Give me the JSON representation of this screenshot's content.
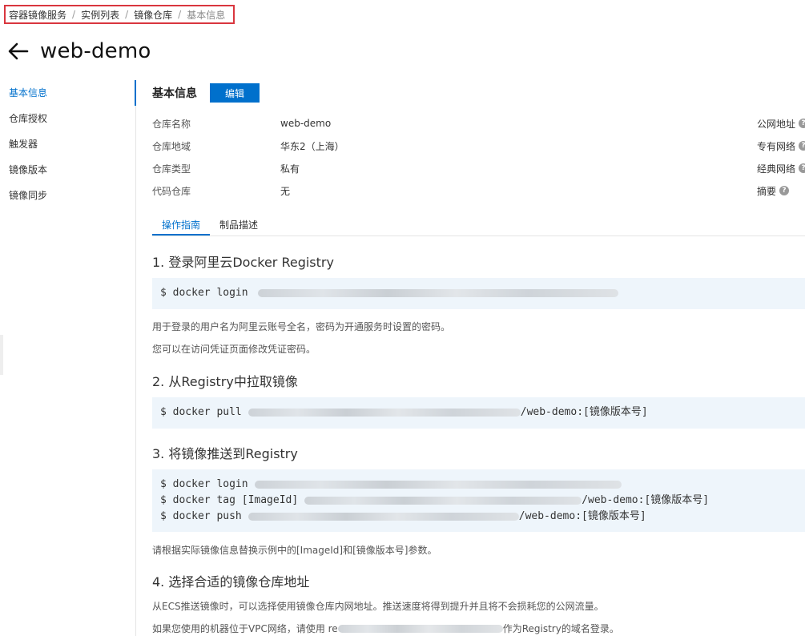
{
  "breadcrumb": {
    "items": [
      "容器镜像服务",
      "实例列表",
      "镜像仓库",
      "基本信息"
    ],
    "separator": "/"
  },
  "header": {
    "back_icon": "arrow-left-icon",
    "title": "web-demo"
  },
  "sidebar": {
    "items": [
      {
        "label": "基本信息",
        "active": true
      },
      {
        "label": "仓库授权",
        "active": false
      },
      {
        "label": "触发器",
        "active": false
      },
      {
        "label": "镜像版本",
        "active": false
      },
      {
        "label": "镜像同步",
        "active": false
      }
    ]
  },
  "basic_info": {
    "title": "基本信息",
    "edit_label": "编辑",
    "fields": [
      {
        "label": "仓库名称",
        "value": "web-demo"
      },
      {
        "label": "仓库地域",
        "value": "华东2（上海）"
      },
      {
        "label": "仓库类型",
        "value": "私有"
      },
      {
        "label": "代码仓库",
        "value": "无"
      }
    ],
    "right_fields": [
      {
        "label": "公网地址",
        "icon": "help-icon"
      },
      {
        "label": "专有网络",
        "icon": "help-icon"
      },
      {
        "label": "经典网络",
        "icon": "help-icon"
      },
      {
        "label": "摘要",
        "icon": "help-icon"
      }
    ]
  },
  "tabs": [
    {
      "label": "操作指南",
      "active": true
    },
    {
      "label": "制品描述",
      "active": false
    }
  ],
  "guide": {
    "step1": {
      "title": "1. 登录阿里云Docker Registry",
      "code": "$ docker login",
      "notes": [
        "用于登录的用户名为阿里云账号全名，密码为开通服务时设置的密码。",
        "您可以在访问凭证页面修改凭证密码。"
      ]
    },
    "step2": {
      "title": "2. 从Registry中拉取镜像",
      "code_prefix": "$ docker pull",
      "code_suffix": "/web-demo:[镜像版本号]"
    },
    "step3": {
      "title": "3. 将镜像推送到Registry",
      "line1": "$ docker login",
      "line2_prefix": "$ docker tag [ImageId]",
      "line2_suffix": "/web-demo:[镜像版本号]",
      "line3_prefix": "$ docker push",
      "line3_suffix": "/web-demo:[镜像版本号]",
      "note": "请根据实际镜像信息替换示例中的[ImageId]和[镜像版本号]参数。"
    },
    "step4": {
      "title": "4. 选择合适的镜像仓库地址",
      "note1": "从ECS推送镜像时，可以选择使用镜像仓库内网地址。推送速度将得到提升并且将不会损耗您的公网流量。",
      "note2_prefix": "如果您使用的机器位于VPC网络，请使用 re",
      "note2_suffix": "作为Registry的域名登录。"
    }
  },
  "colors": {
    "accent": "#0070cc",
    "highlight_border": "#d9363e",
    "code_bg": "#eef5fb"
  }
}
